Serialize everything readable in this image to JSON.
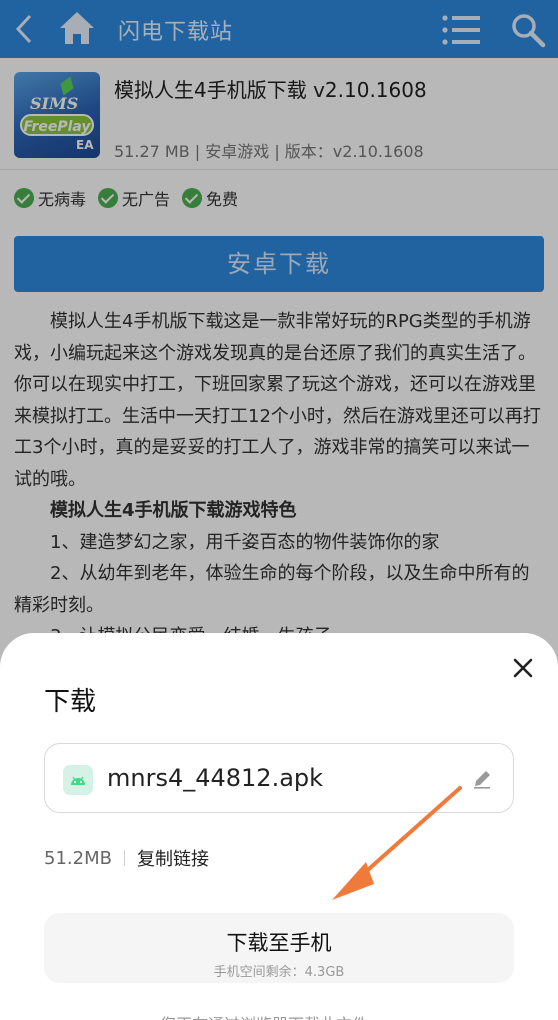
{
  "topbar": {
    "site_title": "闪电下载站",
    "icons": [
      "back-icon",
      "home-icon",
      "menu-list-icon",
      "search-icon"
    ],
    "color": "#2f89e0"
  },
  "app": {
    "name": "模拟人生4手机版下载 v2.10.1608",
    "meta": "51.27 MB | 安卓游戏 | 版本：v2.10.1608",
    "icon_text_1": "SIMS",
    "icon_text_2": "FreePlay",
    "icon_text_3": "EA"
  },
  "badges": [
    {
      "label": "无病毒"
    },
    {
      "label": "无广告"
    },
    {
      "label": "免费"
    }
  ],
  "android_download_label": "安卓下载",
  "article": {
    "intro": "模拟人生4手机版下载这是一款非常好玩的RPG类型的手机游戏，小编玩起来这个游戏发现真的是台还原了我们的真实生活了。你可以在现实中打工，下班回家累了玩这个游戏，还可以在游戏里来模拟打工。生活中一天打工12个小时，然后在游戏里还可以再打工3个小时，真的是妥妥的打工人了，游戏非常的搞笑可以来试一试的哦。",
    "features_title": "模拟人生4手机版下载游戏特色",
    "feature_1": "1、建造梦幻之家，用千姿百态的物件装饰你的家",
    "feature_2": "2、从幼年到老年，体验生命的每个阶段，以及生命中所有的精彩时刻。",
    "feature_3": "3、让模拟公民恋爱、结婚、生孩子。"
  },
  "sheet": {
    "title": "下载",
    "file_name": "mnrs4_44812.apk",
    "file_size": "51.2MB",
    "copy_link": "复制链接",
    "download_to_phone": "下载至手机",
    "storage_left": "手机空间剩余：4.3GB",
    "bottom_hint": "您正在通过浏览器下载此文件"
  },
  "colors": {
    "accent": "#2f89e0",
    "arrow": "#f07a3a",
    "badge_green": "#4caf50"
  }
}
